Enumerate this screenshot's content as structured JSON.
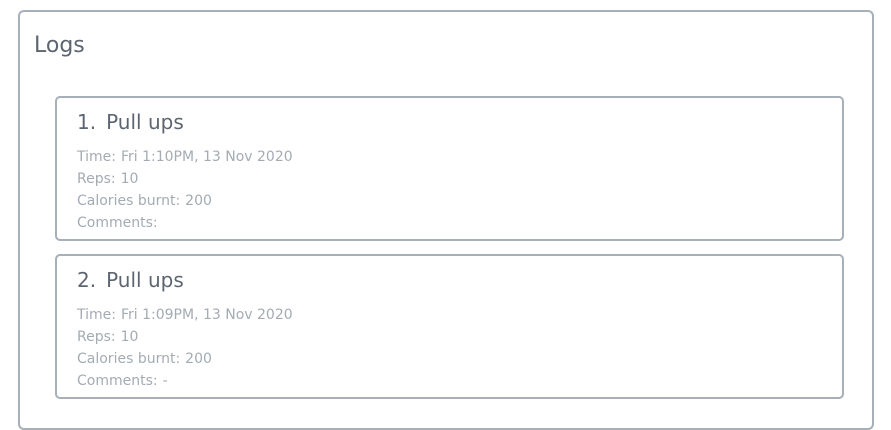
{
  "panel": {
    "title": "Logs"
  },
  "labels": {
    "time": "Time:",
    "reps": "Reps:",
    "calories": "Calories burnt:",
    "comments": "Comments:"
  },
  "logs": [
    {
      "index": "1.",
      "exercise": "Pull ups",
      "time": "Fri 1:10PM, 13 Nov 2020",
      "reps": "10",
      "calories": "200",
      "comments": ""
    },
    {
      "index": "2.",
      "exercise": "Pull ups",
      "time": "Fri 1:09PM, 13 Nov 2020",
      "reps": "10",
      "calories": "200",
      "comments": "-"
    }
  ]
}
